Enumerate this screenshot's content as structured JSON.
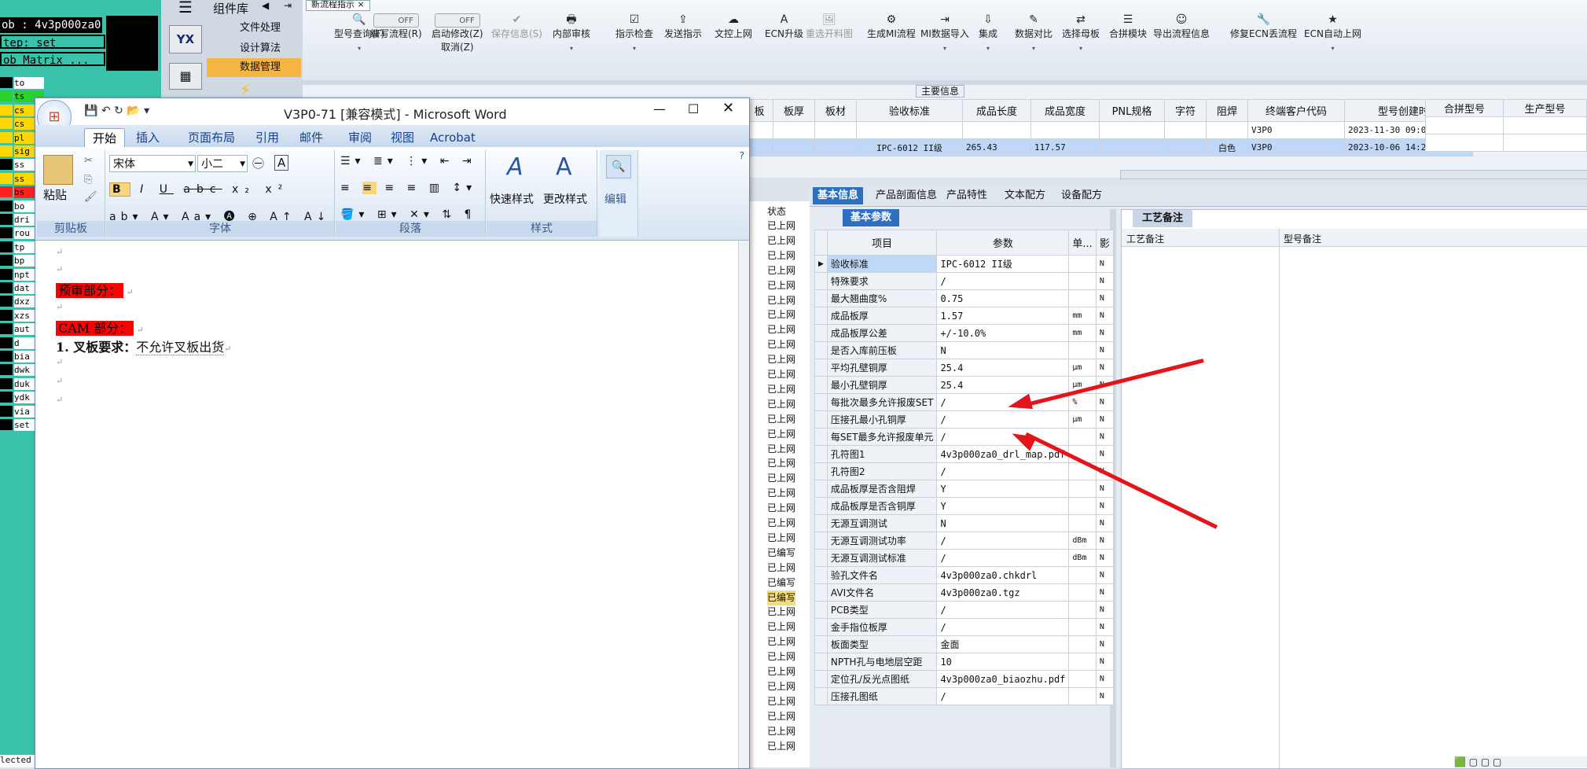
{
  "terminal": {
    "job_line": "ob : 4v3p000za0",
    "step_line": "tep: set",
    "matrix_label": "ob Matrix ...",
    "layers": [
      "to",
      "ts",
      "cs",
      "cs",
      "pl",
      "sig",
      "ss",
      "ss",
      "bs",
      "bo",
      "dri",
      "rou",
      "tp",
      "bp",
      "npt",
      "dat",
      "dxz",
      "xzs",
      "aut",
      "d",
      "bia",
      "dwk",
      "duk",
      "ydk",
      "via",
      "set"
    ],
    "footer": "lected"
  },
  "complib": {
    "title": "组件库",
    "items": [
      "文件处理",
      "设计算法",
      "数据管理"
    ],
    "menu_icon": "hamburger-icon"
  },
  "toolbar": {
    "tab_title": "新流程指示",
    "buttons": [
      {
        "label": "型号查询(F)",
        "icon": "search-icon",
        "disabled": false
      },
      {
        "label": "编写流程(R)",
        "icon": "toggle-off",
        "disabled": false
      },
      {
        "label": "启动修改(Z)",
        "sublabel": "取消(Z)",
        "icon": "toggle-off",
        "disabled": false
      },
      {
        "label": "保存信息(S)",
        "icon": "check-icon",
        "disabled": true
      },
      {
        "label": "内部审核",
        "icon": "print-icon",
        "disabled": false
      },
      {
        "label": "指示检查",
        "icon": "check-box-icon",
        "disabled": false
      },
      {
        "label": "发送指示",
        "icon": "upload-icon",
        "disabled": false
      },
      {
        "label": "文控上网",
        "icon": "cloud-upload-icon",
        "disabled": false
      },
      {
        "label": "ECN升级",
        "icon": "letter-a-icon",
        "disabled": false
      },
      {
        "label": "重选开料图",
        "icon": "image-icon",
        "disabled": true
      },
      {
        "label": "生成MI流程",
        "icon": "gears-icon",
        "disabled": false
      },
      {
        "label": "MI数据导入",
        "icon": "import-icon",
        "disabled": false
      },
      {
        "label": "集成",
        "icon": "download-icon",
        "disabled": false
      },
      {
        "label": "数据对比",
        "icon": "wand-icon",
        "disabled": false
      },
      {
        "label": "选择母板",
        "icon": "shuffle-icon",
        "disabled": false
      },
      {
        "label": "合拼模块",
        "icon": "list-icon",
        "disabled": false
      },
      {
        "label": "导出流程信息",
        "icon": "smile-icon",
        "disabled": false
      },
      {
        "label": "修复ECN丢流程",
        "icon": "wrench-icon",
        "disabled": false
      },
      {
        "label": "ECN自动上网",
        "icon": "star-icon",
        "disabled": false
      }
    ],
    "toggle_text": "OFF"
  },
  "main_info": {
    "section_title": "主要信息",
    "columns": [
      "板",
      "板厚",
      "板材",
      "验收标准",
      "成品长度",
      "成品宽度",
      "PNL规格",
      "字符",
      "阻焊",
      "终端客户代码",
      "型号创建时间"
    ],
    "rows": [
      [
        "",
        "",
        "",
        "",
        "",
        "",
        "",
        "",
        "",
        "V3P0",
        "2023-11-30 09:03:27"
      ],
      [
        "",
        "",
        "",
        "IPC-6012 II级",
        "265.43",
        "117.57",
        "",
        "",
        "白色",
        "V3P0",
        "2023-10-06 14:22:52"
      ]
    ],
    "right_columns": [
      "合拼型号",
      "生产型号"
    ]
  },
  "word": {
    "title": "V3P0-71 [兼容模式] - Microsoft Word",
    "tabs": [
      "开始",
      "插入",
      "页面布局",
      "引用",
      "邮件",
      "审阅",
      "视图",
      "Acrobat"
    ],
    "active_tab": "开始",
    "font_name": "宋体",
    "font_size": "小二",
    "groups": [
      "剪贴板",
      "字体",
      "段落",
      "样式",
      "编辑"
    ],
    "paste_label": "粘贴",
    "quick_style": "快速样式",
    "change_style": "更改样式",
    "edit_label": "编辑",
    "doc": {
      "section1": "预审部分：",
      "section2": "CAM 部分：",
      "item1_label": "1. 叉板要求：",
      "item1_value": "不允许叉板出货"
    }
  },
  "status_column": {
    "header": "状态",
    "values": [
      "已上网",
      "已上网",
      "已上网",
      "已上网",
      "已上网",
      "已上网",
      "已上网",
      "已上网",
      "已上网",
      "已上网",
      "已上网",
      "已上网",
      "已上网",
      "已上网",
      "已上网",
      "已上网",
      "已上网",
      "已上网",
      "已上网",
      "已上网",
      "已上网",
      "已上网",
      "已编写",
      "已上网",
      "已编写",
      "已编写",
      "已上网",
      "已上网",
      "已上网",
      "已上网",
      "已上网",
      "已上网",
      "已上网",
      "已上网",
      "已上网",
      "已上网"
    ]
  },
  "panel": {
    "tabs": [
      "基本信息",
      "产品剖面信息",
      "产品特性",
      "文本配方",
      "设备配方"
    ],
    "active_tab": "基本信息",
    "sub_tab": "基本参数",
    "craft_tab": "工艺备注",
    "craft_cols": [
      "工艺备注",
      "型号备注"
    ],
    "grid_headers": [
      "项目",
      "参数",
      "单...",
      "影"
    ],
    "rows": [
      {
        "item": "验收标准",
        "param": "IPC-6012 II级",
        "unit": "",
        "flag": "N"
      },
      {
        "item": "特殊要求",
        "param": "/",
        "unit": "",
        "flag": "N"
      },
      {
        "item": "最大翘曲度%",
        "param": "0.75",
        "unit": "",
        "flag": "N"
      },
      {
        "item": "成品板厚",
        "param": "1.57",
        "unit": "mm",
        "flag": "N"
      },
      {
        "item": "成品板厚公差",
        "param": "+/-10.0%",
        "unit": "mm",
        "flag": "N"
      },
      {
        "item": "是否入库前压板",
        "param": "N",
        "unit": "",
        "flag": "N"
      },
      {
        "item": "平均孔壁铜厚",
        "param": "25.4",
        "unit": "μm",
        "flag": "N"
      },
      {
        "item": "最小孔壁铜厚",
        "param": "25.4",
        "unit": "μm",
        "flag": "N"
      },
      {
        "item": "每批次最多允许报废SET",
        "param": "/",
        "unit": "%",
        "flag": "N"
      },
      {
        "item": "压接孔最小孔铜厚",
        "param": "/",
        "unit": "μm",
        "flag": "N"
      },
      {
        "item": "每SET最多允许报废单元",
        "param": "/",
        "unit": "",
        "flag": "N"
      },
      {
        "item": "孔符图1",
        "param": "4v3p000za0_drl_map.pdf",
        "unit": "",
        "flag": "N"
      },
      {
        "item": "孔符图2",
        "param": "/",
        "unit": "",
        "flag": "N"
      },
      {
        "item": "成品板厚是否含阻焊",
        "param": "Y",
        "unit": "",
        "flag": "N"
      },
      {
        "item": "成品板厚是否含铜厚",
        "param": "Y",
        "unit": "",
        "flag": "N"
      },
      {
        "item": "无源互调测试",
        "param": "N",
        "unit": "",
        "flag": "N"
      },
      {
        "item": "无源互调测试功率",
        "param": "/",
        "unit": "dBm",
        "flag": "N"
      },
      {
        "item": "无源互调测试标准",
        "param": "/",
        "unit": "dBm",
        "flag": "N"
      },
      {
        "item": "验孔文件名",
        "param": "4v3p000za0.chkdrl",
        "unit": "",
        "flag": "N"
      },
      {
        "item": "AVI文件名",
        "param": "4v3p000za0.tgz",
        "unit": "",
        "flag": "N"
      },
      {
        "item": "PCB类型",
        "param": "/",
        "unit": "",
        "flag": "N"
      },
      {
        "item": "金手指位板厚",
        "param": "/",
        "unit": "",
        "flag": "N"
      },
      {
        "item": "板面类型",
        "param": "金面",
        "unit": "",
        "flag": "N"
      },
      {
        "item": "NPTH孔与电地层空距",
        "param": "10",
        "unit": "",
        "flag": "N"
      },
      {
        "item": "定位孔/反光点图纸",
        "param": "4v3p000za0_biaozhu.pdf",
        "unit": "",
        "flag": "N"
      },
      {
        "item": "压接孔图纸",
        "param": "/",
        "unit": "",
        "flag": "N"
      }
    ]
  },
  "colors": {
    "terminal_bg": "#39c3ac",
    "accent": "#2e6fc1",
    "annotation_arrow": "#e4141b",
    "highlight": "#ff0000"
  }
}
